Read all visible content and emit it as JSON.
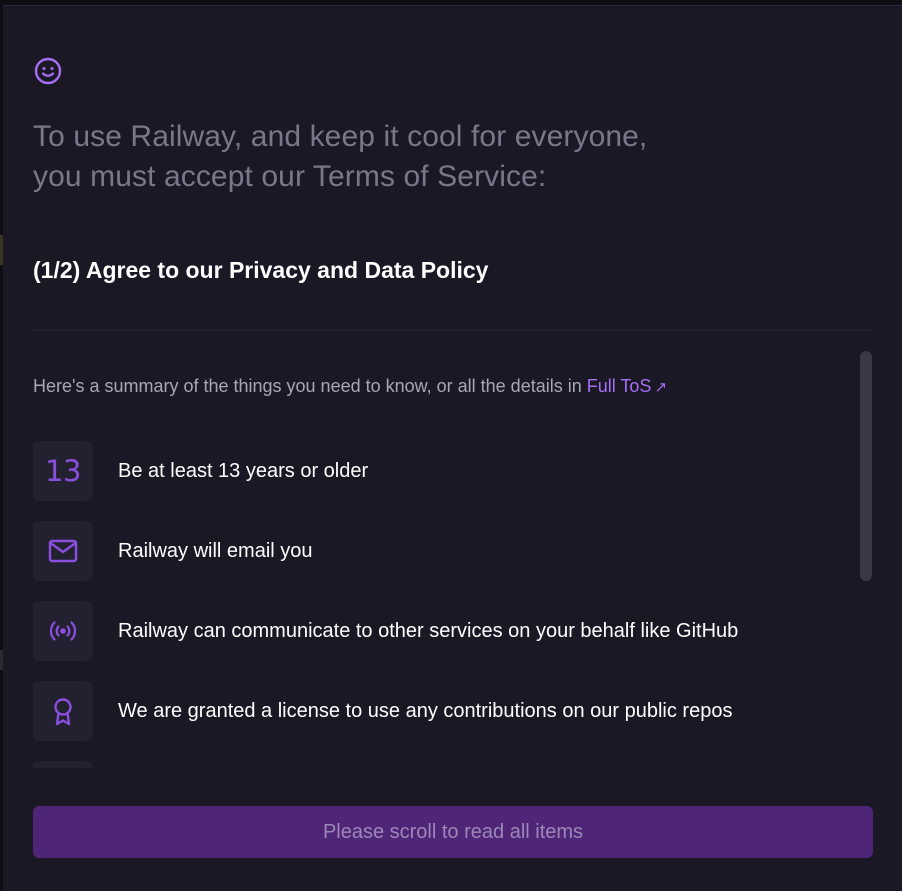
{
  "colors": {
    "background": "#1a1825",
    "accent": "#a66ef3",
    "icon_purple": "#8b4fe0",
    "button_bg": "#4f2677",
    "button_text": "#9c88b8",
    "headline_text": "#7a7888"
  },
  "header": {
    "icon": "smile-icon",
    "headline_line1": "To use Railway, and keep it cool for everyone,",
    "headline_line2": "you must accept our Terms of Service:"
  },
  "step": {
    "title": "(1/2) Agree to our Privacy and Data Policy"
  },
  "summary": {
    "text": "Here's a summary of the things you need to know, or all the details in ",
    "link_label": "Full ToS",
    "link_icon": "external-arrow-icon",
    "link_arrow": "↗"
  },
  "items": [
    {
      "icon": "age-number",
      "number": "13",
      "label": "Be at least 13 years or older"
    },
    {
      "icon": "mail-icon",
      "label": "Railway will email you"
    },
    {
      "icon": "broadcast-icon",
      "label": "Railway can communicate to other services on your behalf like GitHub"
    },
    {
      "icon": "award-ribbon-icon",
      "label": "We are granted a license to use any contributions on our public repos"
    }
  ],
  "footer": {
    "button_label": "Please scroll to read all items"
  }
}
